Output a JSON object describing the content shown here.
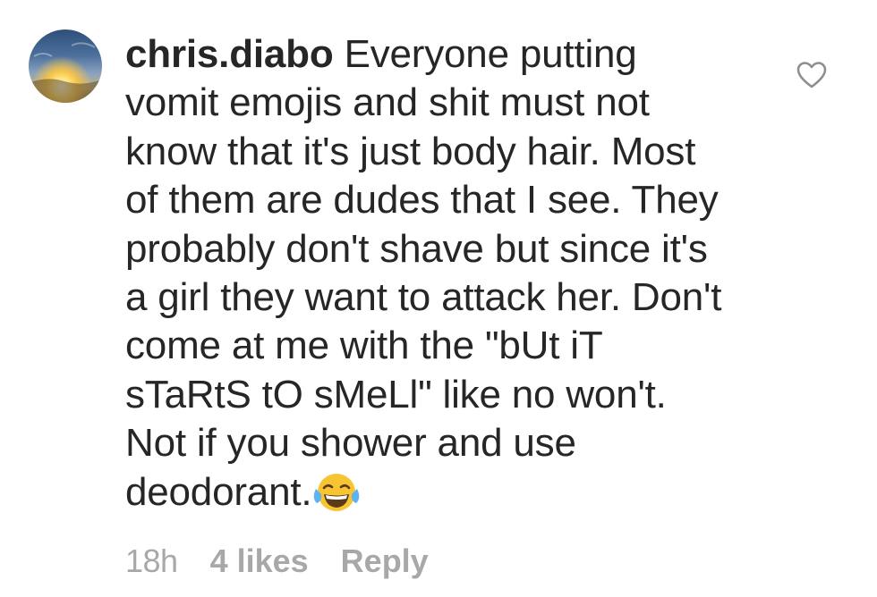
{
  "comment": {
    "username": "chris.diabo",
    "text": "Everyone putting vomit emojis and shit must not know that it's just body hair. Most of them are dudes that I see. They probably don't shave but since it's a girl they want to attack her. Don't come at me with the \"bUt iT sTaRtS tO sMeLl\" like no won't. Not if you shower and use deodorant.",
    "emoji": "face-with-tears-of-joy",
    "time": "18h",
    "likes": "4 likes",
    "reply_label": "Reply"
  },
  "icons": {
    "avatar": "sunset-avatar",
    "like": "heart-outline-icon"
  },
  "colors": {
    "text": "#262626",
    "meta": "#a8a8a8",
    "heart": "#8e8e8e",
    "emoji_face": "#f7c531"
  }
}
